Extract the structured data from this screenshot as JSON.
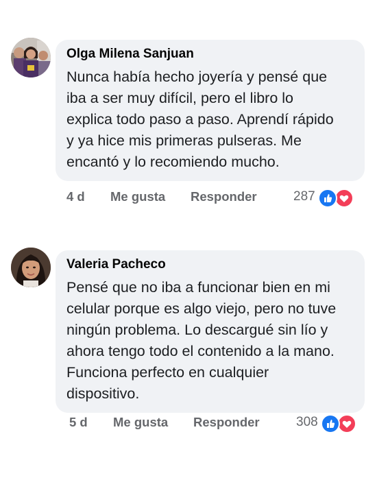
{
  "comments": [
    {
      "author": "Olga Milena Sanjuan",
      "lines": [
        "Nunca había hecho joyería y pensé que",
        "iba a ser muy difícil, pero el libro lo",
        "explica todo paso a paso. Aprendí rápido",
        "y ya hice mis primeras pulseras. Me",
        "encantó y lo recomiendo mucho."
      ],
      "time": "4 d",
      "like_label": "Me gusta",
      "reply_label": "Responder",
      "reaction_count": "287",
      "reactions": [
        "like-icon",
        "love-icon"
      ]
    },
    {
      "author": "Valeria Pacheco",
      "lines": [
        "Pensé que no iba a funcionar bien en mi",
        "celular porque es algo viejo, pero no tuve",
        "ningún problema. Lo descargué sin lío y",
        "ahora tengo todo el contenido a la mano.",
        "Funciona perfecto en cualquier",
        "dispositivo."
      ],
      "time": "5 d",
      "like_label": "Me gusta",
      "reply_label": "Responder",
      "reaction_count": "308",
      "reactions": [
        "like-icon",
        "love-icon"
      ]
    }
  ],
  "colors": {
    "bubble": "#f0f2f5",
    "meta_text": "#65676b",
    "like_blue": "#1877f2",
    "love_red": "#f33e58"
  }
}
